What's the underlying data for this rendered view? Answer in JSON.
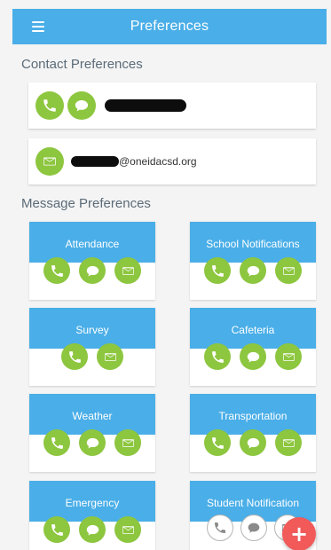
{
  "appbar": {
    "title": "Preferences",
    "menu_icon": "hamburger-menu-icon",
    "color": "#4aaee8"
  },
  "contact_preferences": {
    "title": "Contact Preferences",
    "phone_row": {
      "icons": [
        "phone-icon",
        "chat-bubble-icon"
      ],
      "value_redacted": true
    },
    "email_row": {
      "icons": [
        "envelope-icon"
      ],
      "value_visible": "@oneidacsd.org",
      "value_redacted": true
    }
  },
  "message_preferences": {
    "title": "Message Preferences",
    "cards": [
      {
        "label": "Attendance",
        "channels": [
          "phone",
          "sms",
          "email"
        ]
      },
      {
        "label": "School Notifications",
        "channels": [
          "phone",
          "sms",
          "email"
        ]
      },
      {
        "label": "Survey",
        "channels": [
          "phone",
          "email"
        ]
      },
      {
        "label": "Cafeteria",
        "channels": [
          "phone",
          "sms",
          "email"
        ]
      },
      {
        "label": "Weather",
        "channels": [
          "phone",
          "sms",
          "email"
        ]
      },
      {
        "label": "Transportation",
        "channels": [
          "phone",
          "sms",
          "email"
        ]
      },
      {
        "label": "Emergency",
        "channels": [
          "phone",
          "sms",
          "email"
        ]
      },
      {
        "label": "Student Notification",
        "channels": [
          "phone",
          "sms",
          "email"
        ]
      }
    ]
  },
  "fab": {
    "icon": "plus-icon",
    "symbol": "+",
    "color": "#f25a5a",
    "tray_icons": [
      "phone-icon",
      "chat-bubble-icon",
      "envelope-icon"
    ]
  },
  "colors": {
    "accent": "#4aaee8",
    "channel_active": "#8dc63f",
    "fab": "#f25a5a",
    "section_text": "#5b6b78"
  }
}
